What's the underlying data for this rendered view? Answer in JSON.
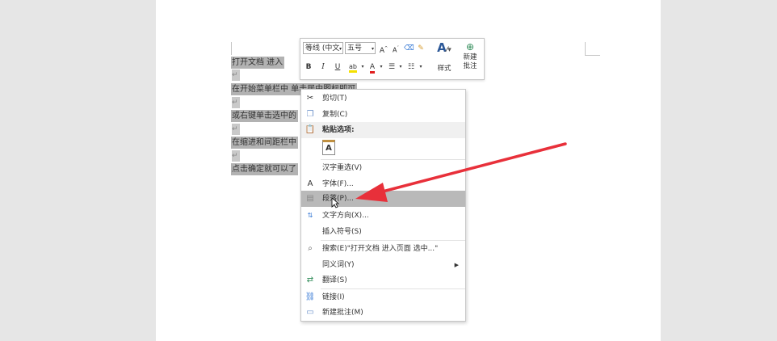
{
  "document": {
    "lines": [
      {
        "text": "打开文档    进入"
      },
      {
        "text": "在开始菜单栏中    单击居中图标即可"
      },
      {
        "text": "或右键单击选中的"
      },
      {
        "text": "在缩进和间距栏中"
      },
      {
        "text": "点击确定就可以了"
      }
    ],
    "paragraph_mark": "↵"
  },
  "mini_toolbar": {
    "font_name": "等线 (中文",
    "font_size": "五号",
    "grow_font": "A",
    "shrink_font": "A",
    "bold": "B",
    "italic": "I",
    "underline": "U",
    "highlight": "ab",
    "font_color": "A",
    "styles_label": "样式",
    "new_comment_label_1": "新建",
    "new_comment_label_2": "批注"
  },
  "context_menu": {
    "items": [
      {
        "label": "剪切(T)"
      },
      {
        "label": "复制(C)"
      },
      {
        "label": "粘贴选项:"
      },
      {
        "label": ""
      },
      {
        "label": "汉字重选(V)"
      },
      {
        "label": "字体(F)..."
      },
      {
        "label": "段落(P)..."
      },
      {
        "label": "文字方向(X)..."
      },
      {
        "label": "插入符号(S)"
      },
      {
        "label": "搜索(E)\"打开文档  进入页面  选中...\""
      },
      {
        "label": "同义词(Y)"
      },
      {
        "label": "翻译(S)"
      },
      {
        "label": "链接(I)"
      },
      {
        "label": "新建批注(M)"
      }
    ],
    "font_icon_glyph": "A"
  },
  "colors": {
    "arrow": "#e8303a",
    "highlight_row": "#b9b9b9",
    "selection": "#b2b2b2"
  }
}
